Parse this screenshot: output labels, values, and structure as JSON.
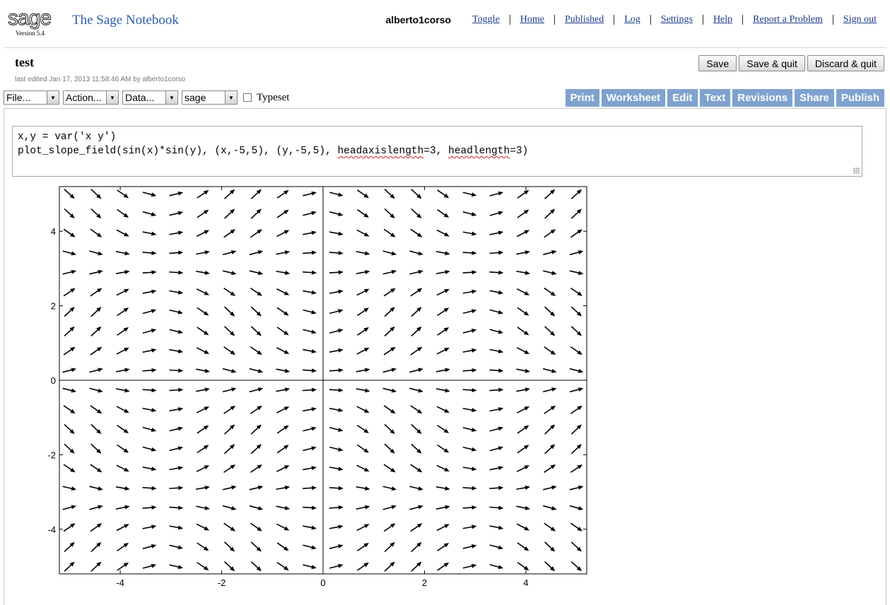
{
  "header": {
    "logo_text": "sage",
    "version": "Version 5.4",
    "app_title": "The Sage Notebook",
    "username": "alberto1corso",
    "nav_links": [
      "Toggle",
      "Home",
      "Published",
      "Log",
      "Settings",
      "Help",
      "Report a Problem",
      "Sign out"
    ]
  },
  "worksheet": {
    "name": "test",
    "last_edited": "last edited Jan 17, 2013 11:58:46 AM by alberto1corso",
    "save_buttons": [
      "Save",
      "Save & quit",
      "Discard & quit"
    ]
  },
  "toolbar": {
    "selects": [
      "File...",
      "Action...",
      "Data...",
      "sage"
    ],
    "typeset_label": "Typeset",
    "typeset_checked": false,
    "tabs": [
      "Print",
      "Worksheet",
      "Edit",
      "Text",
      "Revisions",
      "Share",
      "Publish"
    ]
  },
  "cell": {
    "line1": "x,y = var('x y')",
    "line2_a": "plot_slope_field(sin(x)*sin(y), (x,-5,5), (y,-5,5), ",
    "line2_b": "headaxislength",
    "line2_c": "=3, ",
    "line2_d": "headlength",
    "line2_e": "=3)"
  },
  "chart_data": {
    "type": "scatter",
    "plot_kind": "slope field",
    "function": "sin(x)*sin(y)",
    "xlim": [
      -5.2,
      5.2
    ],
    "ylim": [
      -5.2,
      5.2
    ],
    "xticks": [
      -4,
      -2,
      0,
      2,
      4
    ],
    "yticks": [
      -4,
      -2,
      0,
      2,
      4
    ],
    "xtick_labels": [
      "-4",
      "-2",
      "0",
      "2",
      "4"
    ],
    "ytick_labels": [
      "-4",
      "-2",
      "0",
      "2",
      "4"
    ],
    "grid_points_per_axis": 20,
    "axes_color": "#000000",
    "arrow_color": "#000000",
    "frame": true,
    "grid": false
  }
}
